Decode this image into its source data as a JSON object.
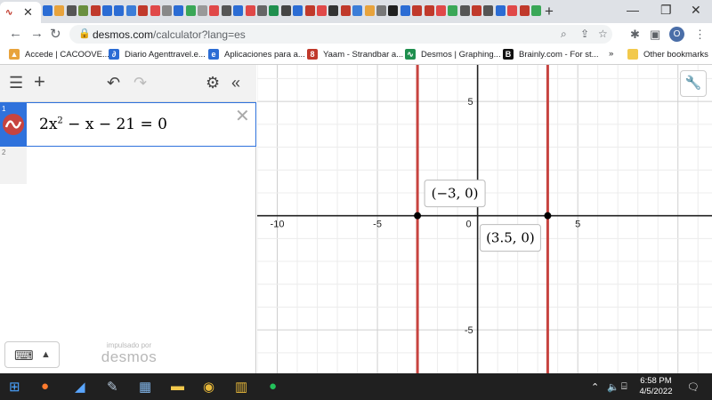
{
  "browser": {
    "active_tab_icon": "desmos-favicon",
    "tab_strip_colors": [
      "#2b6cd4",
      "#e8a33c",
      "#555555",
      "#6a8f3f",
      "#c0392b",
      "#2b6cd4",
      "#2b6cd4",
      "#3b7dd8",
      "#c0392b",
      "#e04848",
      "#888888",
      "#2b6cd4",
      "#3aa757",
      "#999999",
      "#e04848",
      "#555555",
      "#2b6cd4",
      "#e04848",
      "#666666",
      "#1f8f4e",
      "#444444",
      "#2b6cd4",
      "#c0392b",
      "#e04848",
      "#333333",
      "#c0392b",
      "#3b7dd8",
      "#e8a33c",
      "#777777",
      "#1f1f1f",
      "#2b6cd4",
      "#c0392b",
      "#c0392b",
      "#e04848",
      "#3aa757",
      "#555555",
      "#c0392b",
      "#555555",
      "#2b6cd4",
      "#e04848",
      "#c0392b",
      "#3aa757"
    ],
    "url_host": "desmos.com",
    "url_path": "/calculator?lang=es",
    "bookmarks": [
      {
        "label": "Accede | CACOOVE...",
        "icon": "cacoove-icon",
        "color": "#e8a33c"
      },
      {
        "label": "Diario Agenttravel.e...",
        "icon": "agenttravel-icon",
        "color": "#2b6cd4"
      },
      {
        "label": "Aplicaciones para a...",
        "icon": "aplicaciones-icon",
        "color": "#2b6cd4"
      },
      {
        "label": "Yaam - Strandbar a...",
        "icon": "yaam-icon",
        "color": "#c0392b"
      },
      {
        "label": "Desmos | Graphing...",
        "icon": "desmos-icon",
        "color": "#1f8f4e"
      },
      {
        "label": "Brainly.com - For st...",
        "icon": "brainly-icon",
        "color": "#111111"
      }
    ],
    "more_bookmarks": "»",
    "other_bookmarks": "Other bookmarks"
  },
  "desmos": {
    "expressions": [
      {
        "index": "1",
        "latex_parts": [
          "2x",
          "2",
          " − x − 21 = 0"
        ],
        "color": "#c74440"
      },
      {
        "index": "2"
      }
    ],
    "powered_by_small": "impulsado por",
    "powered_by_brand": "desmos"
  },
  "graph": {
    "x_range": [
      -11,
      11.7
    ],
    "y_range": [
      -6.9,
      6.6
    ],
    "x_ticks": [
      "-10",
      "-5",
      "0",
      "5"
    ],
    "y_ticks": [
      "5",
      "-5"
    ],
    "tick_values_x": [
      -10,
      -5,
      0,
      5
    ],
    "tick_values_y": [
      5,
      -5
    ],
    "vertical_lines": [
      -3,
      3.5
    ],
    "line_color": "#c74440",
    "points": [
      {
        "x": -3,
        "y": 0,
        "label": "(−3, 0)"
      },
      {
        "x": 3.5,
        "y": 0,
        "label": "(3.5, 0)"
      }
    ]
  },
  "taskbar": {
    "time": "6:58 PM",
    "date": "4/5/2022"
  }
}
